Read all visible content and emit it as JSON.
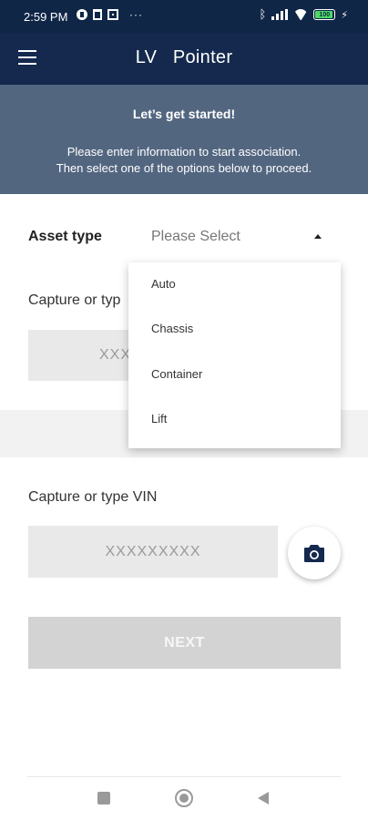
{
  "status_bar": {
    "time": "2:59 PM",
    "more": "···",
    "battery": "100",
    "bluetooth_icon": "bluetooth-icon",
    "battery_color": "#4cd964",
    "battery_level": 1.0
  },
  "app_bar": {
    "title": "LV   Pointer",
    "menu_icon": "hamburger-menu-icon",
    "background": "#14294d"
  },
  "hero": {
    "title": "Let’s get started!",
    "line1": "Please enter information to start association.",
    "line2": "Then select one of the options below to proceed.",
    "background": "#536680"
  },
  "form": {
    "asset_type_label": "Asset type",
    "asset_type_placeholder": "Please Select",
    "capture_label_partial": "Capture or typ",
    "partial_input_value": "XXX",
    "vin_label": "Capture or type VIN",
    "vin_placeholder": "XXXXXXXXX",
    "camera_icon": "camera-icon",
    "next_label": "NEXT"
  },
  "dropdown": {
    "options": [
      "Auto",
      "Chassis",
      "Container",
      "Lift"
    ]
  },
  "nav_bar": {
    "recent_icon": "recent-apps-icon",
    "home_icon": "home-icon",
    "back_icon": "back-icon"
  }
}
